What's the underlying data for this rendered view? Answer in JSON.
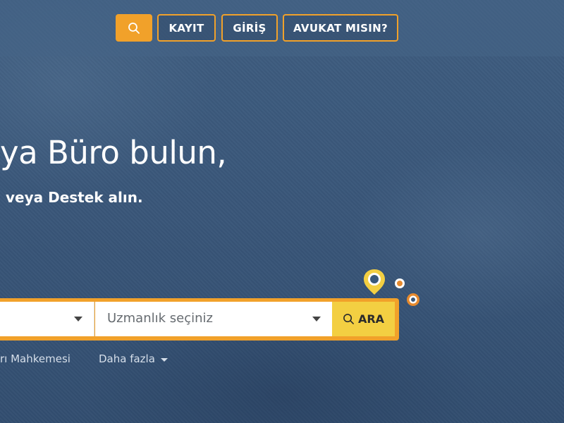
{
  "header": {
    "search_icon": "search-icon",
    "register_label": "KAYIT",
    "login_label": "GİRİŞ",
    "lawyer_label": "AVUKAT MISIN?"
  },
  "hero": {
    "title": "ya Büro bulun,",
    "subtitle": "veya Destek alın."
  },
  "search": {
    "location_value": "",
    "expertise_placeholder": "Uzmanlık seçiniz",
    "submit_label": "ARA",
    "submit_icon": "search-icon"
  },
  "quick_links": {
    "court": "rı Mahkemesi",
    "more": "Daha fazla"
  },
  "colors": {
    "accent": "#f1a12a",
    "button_yellow": "#f3cf42",
    "background": "#3a587a"
  }
}
